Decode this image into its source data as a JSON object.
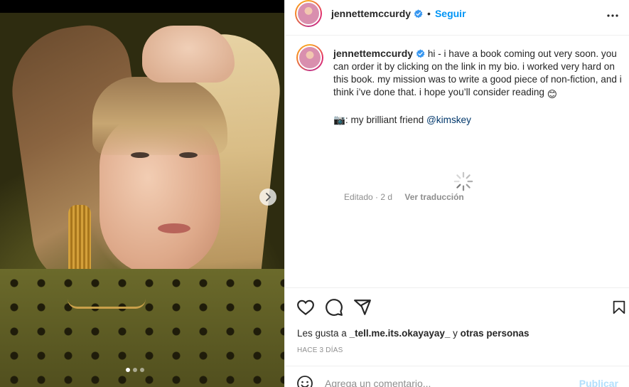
{
  "post": {
    "username": "jennettemccurdy",
    "verified": true,
    "follow_label": "Seguir",
    "separator": "•",
    "caption_text": "hi - i have a book coming out very soon. you can order it by clicking on the link in my bio. i worked very hard on this book. my mission was to write a good piece of non-fiction, and i think i’ve done that. i hope you’ll consider reading",
    "caption_emoji": "😊",
    "credit_prefix": "📷: my brilliant friend ",
    "credit_mention": "@kimskey",
    "edited_label": "Editado · 2 d",
    "translate_label": "Ver traducción"
  },
  "engagement": {
    "likes_prefix": "Les gusta a ",
    "likes_user": "_tell.me.its.okayayay_",
    "likes_middle": " y ",
    "likes_others": "otras personas",
    "timestamp": "HACE 3 DÍAS"
  },
  "comment": {
    "placeholder": "Agrega un comentario...",
    "publish_label": "Publicar"
  },
  "carousel": {
    "total_slides": 3,
    "active_slide": 1
  },
  "icons": {
    "like": "heart-icon",
    "comment": "comment-icon",
    "share": "share-icon",
    "save": "bookmark-icon",
    "more": "more-options-icon",
    "verified": "verified-badge-icon",
    "next": "chevron-right-icon",
    "emoji": "emoji-icon",
    "loading": "spinner-icon"
  },
  "colors": {
    "accent": "#0095f6",
    "verified": "#3897f0",
    "mention": "#00376b",
    "muted": "#8e8e8e",
    "publish_disabled": "#b2dffc"
  }
}
